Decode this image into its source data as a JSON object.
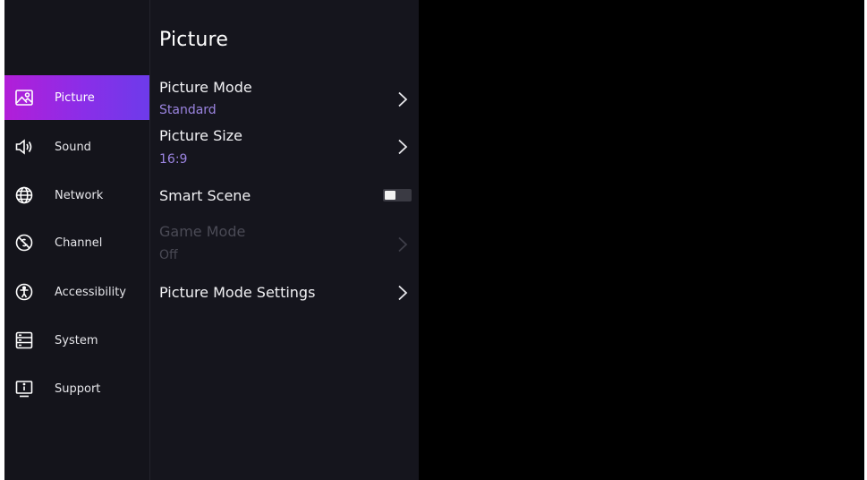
{
  "sidebar": {
    "items": [
      {
        "label": "Picture",
        "icon": "picture-icon",
        "active": true
      },
      {
        "label": "Sound",
        "icon": "speaker-icon",
        "active": false
      },
      {
        "label": "Network",
        "icon": "globe-icon",
        "active": false
      },
      {
        "label": "Channel",
        "icon": "channel-icon",
        "active": false
      },
      {
        "label": "Accessibility",
        "icon": "accessibility-icon",
        "active": false
      },
      {
        "label": "System",
        "icon": "system-icon",
        "active": false
      },
      {
        "label": "Support",
        "icon": "support-icon",
        "active": false
      }
    ]
  },
  "panel": {
    "title": "Picture",
    "items": [
      {
        "label": "Picture Mode",
        "value": "Standard",
        "control": "chevron",
        "enabled": true
      },
      {
        "label": "Picture Size",
        "value": "16:9",
        "control": "chevron",
        "enabled": true
      },
      {
        "label": "Smart Scene",
        "value": "",
        "control": "toggle",
        "toggle_on": false,
        "enabled": true
      },
      {
        "label": "Game Mode",
        "value": "Off",
        "control": "chevron",
        "enabled": false
      },
      {
        "label": "Picture Mode Settings",
        "value": "",
        "control": "chevron",
        "enabled": true
      }
    ]
  },
  "colors": {
    "accent_start": "#b21ed8",
    "accent_end": "#6d3bea",
    "value_text": "#9b84e0",
    "panel_bg": "#15151d",
    "sidebar_bg": "#14141b"
  }
}
